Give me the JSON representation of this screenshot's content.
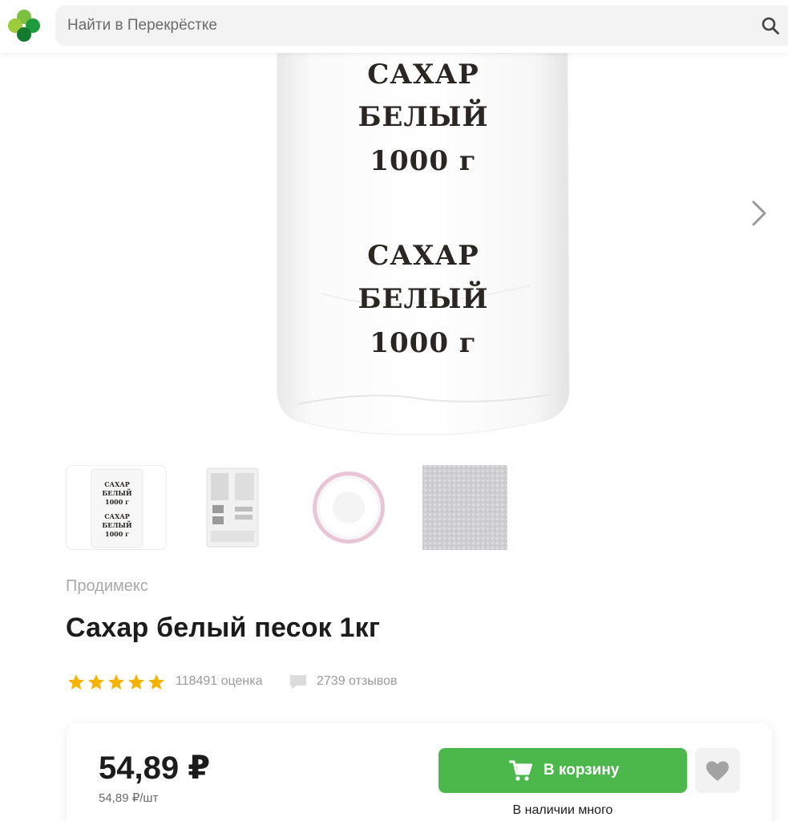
{
  "search": {
    "placeholder": "Найти в Перекрёстке"
  },
  "product_image": {
    "bag_lines": [
      "САХАР",
      "БЕЛЫЙ",
      "1000 г",
      "САХАР",
      "БЕЛЫЙ",
      "1000 г"
    ]
  },
  "thumbnails": [
    {
      "name": "front",
      "lines": [
        "САХАР",
        "БЕЛЫЙ",
        "1000 г",
        "САХАР",
        "БЕЛЫЙ",
        "1000 г"
      ]
    },
    {
      "name": "back"
    },
    {
      "name": "bowl"
    },
    {
      "name": "texture"
    }
  ],
  "product": {
    "brand": "Продимекс",
    "title": "Сахар белый песок 1кг"
  },
  "rating": {
    "stars": 5,
    "count_label": "118491 оценка",
    "reviews_label": "2739 отзывов"
  },
  "price_card": {
    "price": "54,89 ₽",
    "unit_price": "54,89 ₽/шт",
    "cart_label": "В корзину",
    "stock": "В наличии много"
  },
  "colors": {
    "accent_green": "#4cb84c",
    "logo_light": "#7cc142",
    "logo_dark": "#1e9a3c",
    "star": "#f5b301"
  },
  "icons": [
    "perekrestok-logo",
    "search-icon",
    "chevron-right-icon",
    "star-icon",
    "comment-icon",
    "cart-icon",
    "heart-icon"
  ]
}
